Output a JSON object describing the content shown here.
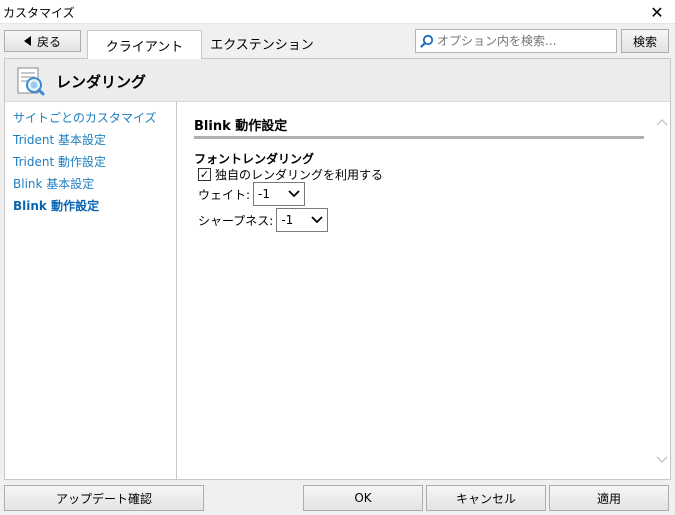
{
  "window": {
    "title": "カスタマイズ",
    "close_glyph": "✕"
  },
  "toolbar": {
    "back_label": "戻る",
    "tabs": [
      {
        "label": "クライアント",
        "active": true
      },
      {
        "label": "エクステンション",
        "active": false
      }
    ],
    "search_placeholder": "オプション内を検索...",
    "search_button": "検索"
  },
  "header": {
    "title": "レンダリング",
    "icon": "rendering-page-icon"
  },
  "sidebar": {
    "items": [
      {
        "label": "サイトごとのカスタマイズ",
        "current": false
      },
      {
        "label": "Trident 基本設定",
        "current": false
      },
      {
        "label": "Trident 動作設定",
        "current": false
      },
      {
        "label": "Blink 基本設定",
        "current": false
      },
      {
        "label": "Blink 動作設定",
        "current": true
      }
    ]
  },
  "content": {
    "section_title": "Blink 動作設定",
    "group_title": "フォントレンダリング",
    "custom_rendering": {
      "label": "独自のレンダリングを利用する",
      "checked": true
    },
    "weight": {
      "label": "ウェイト:",
      "value": "-1"
    },
    "sharpness": {
      "label": "シャープネス:",
      "value": "-1"
    }
  },
  "footer": {
    "update_check": "アップデート確認",
    "ok": "OK",
    "cancel": "キャンセル",
    "apply": "適用"
  },
  "colors": {
    "link": "#1c7fc1",
    "header_band": "#ececec"
  }
}
